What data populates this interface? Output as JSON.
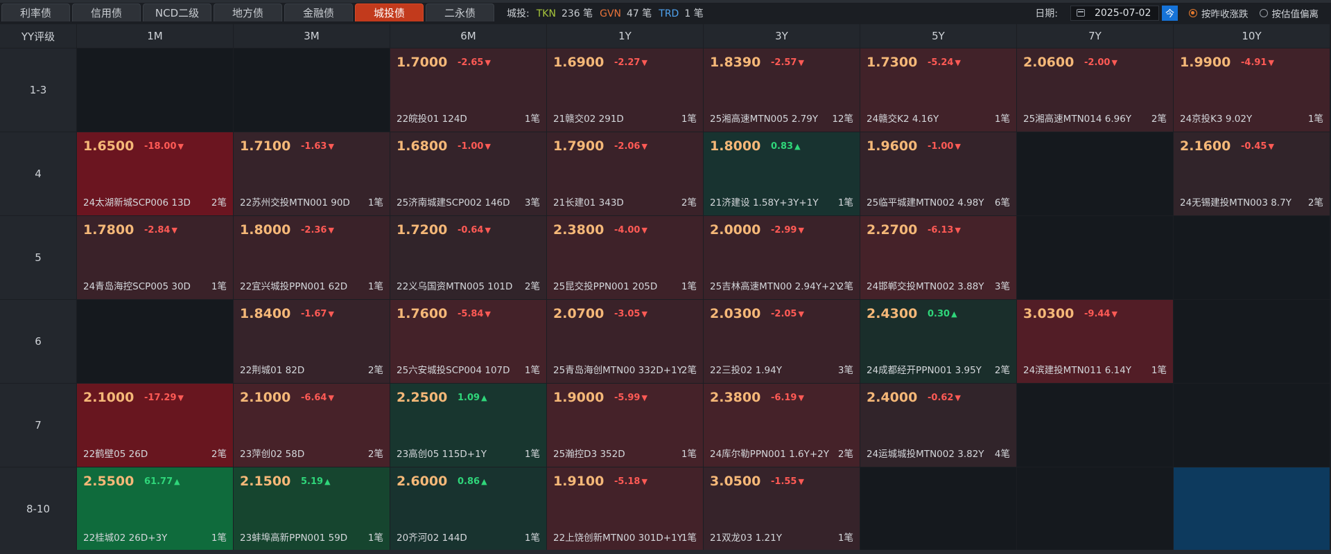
{
  "tabs": [
    "利率债",
    "信用债",
    "NCD二级",
    "地方债",
    "金融债",
    "城投债",
    "二永债"
  ],
  "active_tab": 5,
  "stats": {
    "label": "城投:",
    "items": [
      {
        "code": "TKN",
        "count": "236 笔",
        "color": "#a7c53b"
      },
      {
        "code": "GVN",
        "count": "47 笔",
        "color": "#e8733a"
      },
      {
        "code": "TRD",
        "count": "1 笔",
        "color": "#4fa3f0"
      }
    ]
  },
  "date": {
    "label": "日期:",
    "value": "2025-07-02",
    "today": "今"
  },
  "sort_options": [
    {
      "label": "按昨收涨跌",
      "checked": true
    },
    {
      "label": "按估值偏离",
      "checked": false
    }
  ],
  "grid": {
    "corner": "YY评级",
    "columns": [
      "1M",
      "3M",
      "6M",
      "1Y",
      "3Y",
      "5Y",
      "7Y",
      "10Y"
    ],
    "rows": [
      {
        "label": "1-3",
        "cells": [
          null,
          null,
          {
            "y": "1.7000",
            "c": "-2.65",
            "n": "22皖投01 124D",
            "k": "1笔",
            "bg": "#3a2229"
          },
          {
            "y": "1.6900",
            "c": "-2.27",
            "n": "21赣交02 291D",
            "k": "1笔",
            "bg": "#3a2229"
          },
          {
            "y": "1.8390",
            "c": "-2.57",
            "n": "25湘高速MTN005 2.79Y",
            "k": "12笔",
            "bg": "#3a2229"
          },
          {
            "y": "1.7300",
            "c": "-5.24",
            "n": "24赣交K2 4.16Y",
            "k": "1笔",
            "bg": "#412229"
          },
          {
            "y": "2.0600",
            "c": "-2.00",
            "n": "25湘高速MTN014 6.96Y",
            "k": "2笔",
            "bg": "#3a2229"
          },
          {
            "y": "1.9900",
            "c": "-4.91",
            "n": "24京投K3 9.02Y",
            "k": "1笔",
            "bg": "#402229"
          }
        ]
      },
      {
        "label": "4",
        "cells": [
          {
            "y": "1.6500",
            "c": "-18.00",
            "n": "24太湖新城SCP006 13D",
            "k": "2笔",
            "bg": "#6b1520"
          },
          {
            "y": "1.7100",
            "c": "-1.63",
            "n": "22苏州交投MTN001 90D",
            "k": "1笔",
            "bg": "#36232a"
          },
          {
            "y": "1.6800",
            "c": "-1.00",
            "n": "25济南城建SCP002 146D",
            "k": "3笔",
            "bg": "#34232a"
          },
          {
            "y": "1.7900",
            "c": "-2.06",
            "n": "21长建01 343D",
            "k": "2笔",
            "bg": "#3a2229"
          },
          {
            "y": "1.8000",
            "c": "0.83",
            "n": "21济建设 1.58Y+3Y+1Y",
            "k": "1笔",
            "bg": "#183330"
          },
          {
            "y": "1.9600",
            "c": "-1.00",
            "n": "25临平城建MTN002 4.98Y",
            "k": "6笔",
            "bg": "#34232a"
          },
          null,
          {
            "y": "2.1600",
            "c": "-0.45",
            "n": "24无锡建投MTN003 8.7Y",
            "k": "2笔",
            "bg": "#31242a"
          }
        ]
      },
      {
        "label": "5",
        "cells": [
          {
            "y": "1.7800",
            "c": "-2.84",
            "n": "24青岛海控SCP005 30D",
            "k": "1笔",
            "bg": "#3a2229"
          },
          {
            "y": "1.8000",
            "c": "-2.36",
            "n": "22宜兴城投PPN001 62D",
            "k": "1笔",
            "bg": "#3a2229"
          },
          {
            "y": "1.7200",
            "c": "-0.64",
            "n": "22义乌国资MTN005 101D",
            "k": "2笔",
            "bg": "#31242a"
          },
          {
            "y": "2.3800",
            "c": "-4.00",
            "n": "25昆交投PPN001 205D",
            "k": "1笔",
            "bg": "#3e2229"
          },
          {
            "y": "2.0000",
            "c": "-2.99",
            "n": "25吉林高速MTN00 2.94Y+2Y",
            "k": "2笔",
            "bg": "#3a2229"
          },
          {
            "y": "2.2700",
            "c": "-6.13",
            "n": "24邯郸交投MTN002 3.88Y",
            "k": "3笔",
            "bg": "#452229"
          },
          null,
          null
        ]
      },
      {
        "label": "6",
        "cells": [
          null,
          {
            "y": "1.8400",
            "c": "-1.67",
            "n": "22荆城01 82D",
            "k": "2笔",
            "bg": "#36232a"
          },
          {
            "y": "1.7600",
            "c": "-5.84",
            "n": "25六安城投SCP004 107D",
            "k": "1笔",
            "bg": "#442229"
          },
          {
            "y": "2.0700",
            "c": "-3.05",
            "n": "25青岛海创MTN00 332D+1Y",
            "k": "2笔",
            "bg": "#3a2229"
          },
          {
            "y": "2.0300",
            "c": "-2.05",
            "n": "22三投02 1.94Y",
            "k": "3笔",
            "bg": "#3a2229"
          },
          {
            "y": "2.4300",
            "c": "0.30",
            "n": "24成都经开PPN001 3.95Y",
            "k": "2笔",
            "bg": "#1a2e2b"
          },
          {
            "y": "3.0300",
            "c": "-9.44",
            "n": "24滨建投MTN011 6.14Y",
            "k": "1笔",
            "bg": "#521d26"
          },
          null
        ]
      },
      {
        "label": "7",
        "cells": [
          {
            "y": "2.1000",
            "c": "-17.29",
            "n": "22鹤壁05 26D",
            "k": "2笔",
            "bg": "#68161f"
          },
          {
            "y": "2.1000",
            "c": "-6.64",
            "n": "23萍创02 58D",
            "k": "2笔",
            "bg": "#472229"
          },
          {
            "y": "2.2500",
            "c": "1.09",
            "n": "23高创05 115D+1Y",
            "k": "1笔",
            "bg": "#18362f"
          },
          {
            "y": "1.9000",
            "c": "-5.99",
            "n": "25瀚控D3 352D",
            "k": "1笔",
            "bg": "#452229"
          },
          {
            "y": "2.3800",
            "c": "-6.19",
            "n": "24库尔勒PPN001 1.6Y+2Y",
            "k": "2笔",
            "bg": "#452229"
          },
          {
            "y": "2.4000",
            "c": "-0.62",
            "n": "24运城城投MTN002 3.82Y",
            "k": "4笔",
            "bg": "#31242a"
          },
          null,
          null
        ]
      },
      {
        "label": "8-10",
        "cells": [
          {
            "y": "2.5500",
            "c": "61.77",
            "n": "22桂城02 26D+3Y",
            "k": "1笔",
            "bg": "#0f6b3c"
          },
          {
            "y": "2.1500",
            "c": "5.19",
            "n": "23蚌埠高新PPN001 59D",
            "k": "1笔",
            "bg": "#16452f"
          },
          {
            "y": "2.6000",
            "c": "0.86",
            "n": "20齐河02 144D",
            "k": "1笔",
            "bg": "#18332f"
          },
          {
            "y": "1.9100",
            "c": "-5.18",
            "n": "22上饶创新MTN00 301D+1Y",
            "k": "1笔",
            "bg": "#432229"
          },
          {
            "y": "3.0500",
            "c": "-1.55",
            "n": "21双龙03 1.21Y",
            "k": "1笔",
            "bg": "#36232a"
          },
          null,
          null,
          "blue"
        ]
      }
    ]
  },
  "colors": {
    "down": "#ff5a55",
    "up": "#2fd67a",
    "yield": "#f5b878",
    "active_tab": "#c23a1c"
  }
}
